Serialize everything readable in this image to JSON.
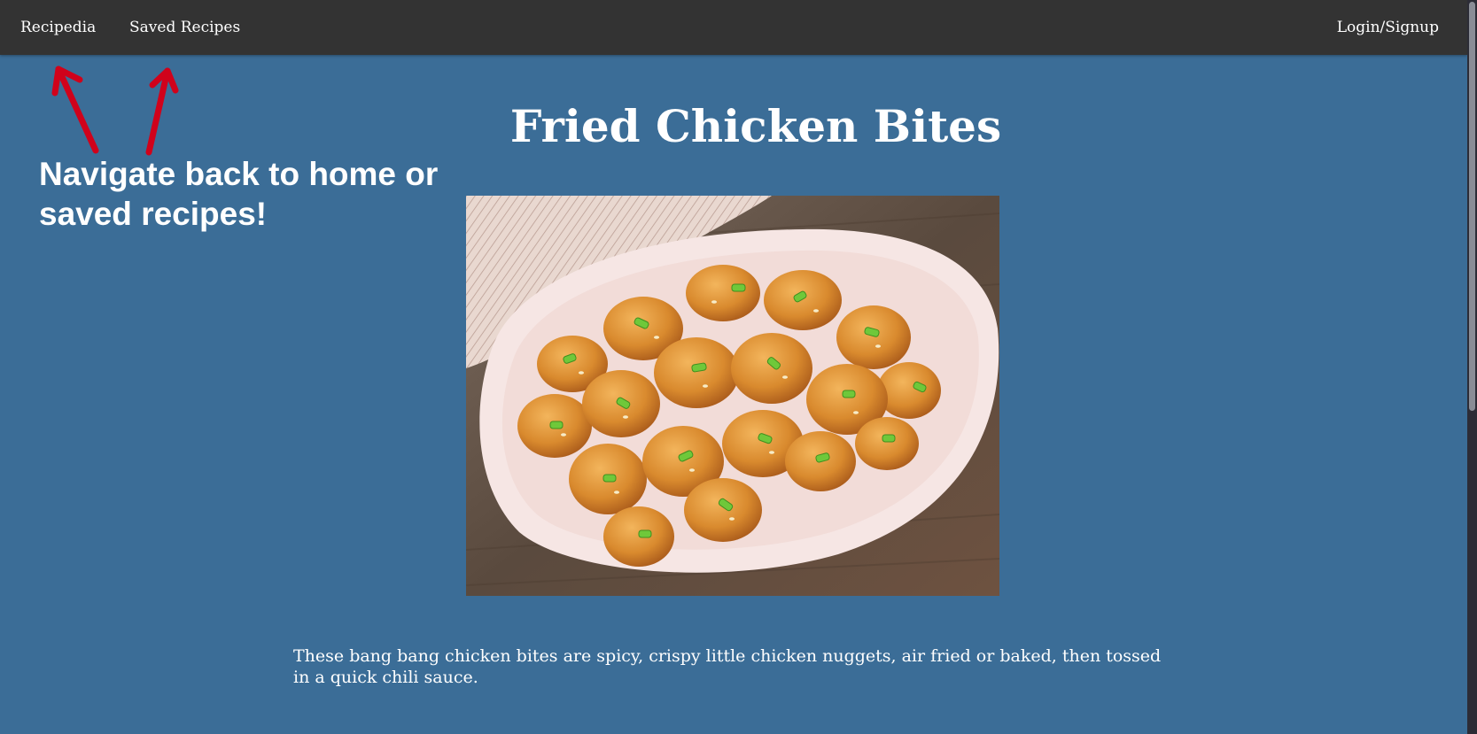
{
  "navbar": {
    "home_label": "Recipedia",
    "saved_label": "Saved Recipes",
    "login_label": "Login/Signup"
  },
  "annotation": {
    "text": "Navigate back to home or saved recipes!",
    "arrow_color": "#d0021b",
    "arrow_icon": "arrow-up-icon"
  },
  "recipe": {
    "title": "Fried Chicken Bites",
    "image_alt": "photo of fried chicken bites on a plate",
    "description": "These bang bang chicken bites are spicy, crispy little chicken nuggets, air fried or baked, then tossed in a quick chili sauce."
  },
  "colors": {
    "page_background": "#3b6d97",
    "navbar_background": "#333333",
    "text": "#ffffff"
  }
}
